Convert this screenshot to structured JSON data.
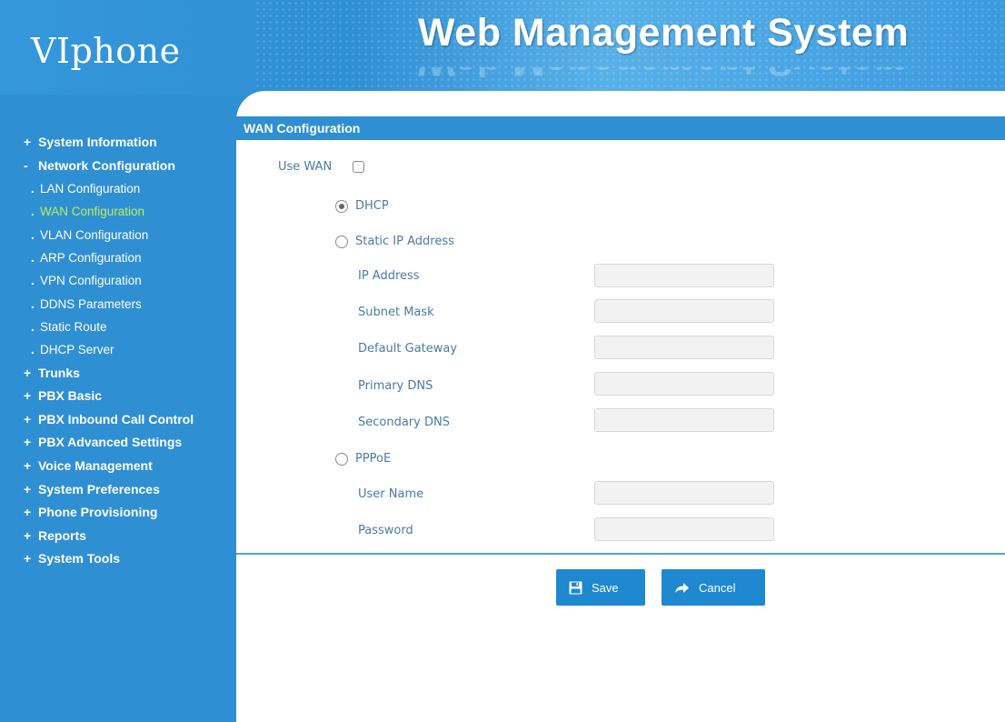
{
  "header": {
    "logo_text": "VIphone",
    "title": "Web Management System"
  },
  "sidebar": {
    "items": [
      {
        "label": "System Information",
        "marker": "+",
        "level": 0
      },
      {
        "label": "Network Configuration",
        "marker": "-",
        "level": 0
      },
      {
        "label": "LAN Configuration",
        "marker": ".",
        "level": 1
      },
      {
        "label": "WAN Configuration",
        "marker": ".",
        "level": 1,
        "active": true
      },
      {
        "label": "VLAN Configuration",
        "marker": ".",
        "level": 1
      },
      {
        "label": "ARP Configuration",
        "marker": ".",
        "level": 1
      },
      {
        "label": "VPN Configuration",
        "marker": ".",
        "level": 1
      },
      {
        "label": "DDNS Parameters",
        "marker": ".",
        "level": 1
      },
      {
        "label": "Static Route",
        "marker": ".",
        "level": 1
      },
      {
        "label": "DHCP Server",
        "marker": ".",
        "level": 1
      },
      {
        "label": "Trunks",
        "marker": "+",
        "level": 0
      },
      {
        "label": "PBX Basic",
        "marker": "+",
        "level": 0
      },
      {
        "label": "PBX Inbound Call Control",
        "marker": "+",
        "level": 0
      },
      {
        "label": "PBX Advanced Settings",
        "marker": "+",
        "level": 0
      },
      {
        "label": "Voice Management",
        "marker": "+",
        "level": 0
      },
      {
        "label": "System Preferences",
        "marker": "+",
        "level": 0
      },
      {
        "label": "Phone Provisioning",
        "marker": "+",
        "level": 0
      },
      {
        "label": "Reports",
        "marker": "+",
        "level": 0
      },
      {
        "label": "System Tools",
        "marker": "+",
        "level": 0
      }
    ]
  },
  "panel": {
    "title": "WAN Configuration",
    "use_wan_label": "Use WAN",
    "use_wan_checked": false,
    "dhcp_label": "DHCP",
    "static_label": "Static IP Address",
    "pppoe_label": "PPPoE",
    "selected_mode": "DHCP",
    "fields": {
      "ip_address": {
        "label": "IP Address",
        "value": ""
      },
      "subnet_mask": {
        "label": "Subnet Mask",
        "value": ""
      },
      "default_gateway": {
        "label": "Default Gateway",
        "value": ""
      },
      "primary_dns": {
        "label": "Primary DNS",
        "value": ""
      },
      "secondary_dns": {
        "label": "Secondary DNS",
        "value": ""
      },
      "user_name": {
        "label": "User Name",
        "value": ""
      },
      "password": {
        "label": "Password",
        "value": ""
      }
    }
  },
  "buttons": {
    "save_label": "Save",
    "cancel_label": "Cancel",
    "save_icon": "floppy-disk-icon",
    "cancel_icon": "arrow-right-icon"
  },
  "colors": {
    "brand_blue": "#2f8fd3",
    "button_blue": "#1e88d0",
    "active_nav": "#b8f05a",
    "label_text": "#4a7aa6"
  }
}
